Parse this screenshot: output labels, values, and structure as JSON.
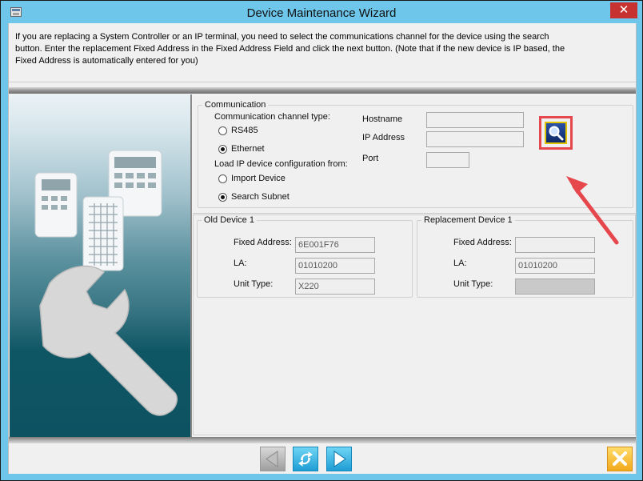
{
  "window": {
    "title": "Device Maintenance Wizard",
    "close_glyph": "✕"
  },
  "instructions": {
    "line1": "If you are replacing a System Controller or an IP terminal, you need to select the communications channel for the device using the search",
    "line2": "button. Enter the replacement Fixed Address in the Fixed Address Field and click the next button. (Note that if the new device is IP based, the",
    "line3": "Fixed Address is automatically entered for you)"
  },
  "communication": {
    "legend": "Communication",
    "channel_type_label": "Communication channel type:",
    "channel_options": [
      {
        "label": "RS485",
        "selected": false
      },
      {
        "label": "Ethernet",
        "selected": true
      }
    ],
    "load_config_label": "Load IP device configuration from:",
    "load_options": [
      {
        "label": "Import Device",
        "selected": false
      },
      {
        "label": "Search Subnet",
        "selected": true
      }
    ],
    "hostname_label": "Hostname",
    "hostname_value": "",
    "ip_label": "IP Address",
    "ip_value": "",
    "port_label": "Port",
    "port_value": "",
    "search_icon": "search-icon"
  },
  "old_device": {
    "legend": "Old Device 1",
    "fixed_address_label": "Fixed Address:",
    "fixed_address_value": "6E001F76",
    "la_label": "LA:",
    "la_value": "01010200",
    "unit_type_label": "Unit Type:",
    "unit_type_value": "X220"
  },
  "replacement_device": {
    "legend": "Replacement Device 1",
    "fixed_address_label": "Fixed Address:",
    "fixed_address_value": "",
    "la_label": "LA:",
    "la_value": "01010200",
    "unit_type_label": "Unit Type:",
    "unit_type_value": ""
  },
  "footer": {
    "back_icon": "back-arrow-icon",
    "refresh_icon": "refresh-icon",
    "next_icon": "next-arrow-icon",
    "cancel_icon": "cancel-icon"
  },
  "colors": {
    "titlebar": "#6ec6ea",
    "close_button": "#c7312f",
    "highlight": "#e5474d",
    "nav_blue": "#1f9ed4",
    "cancel_orange": "#f2a91c"
  }
}
